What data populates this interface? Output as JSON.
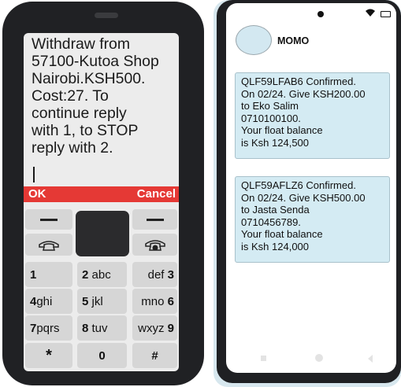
{
  "feature_phone": {
    "message": "Withdraw from\n57100-Kutoa Shop\nNairobi.KSH500.\nCost:27. To\ncontinue reply\nwith 1, to STOP\nreply with 2.",
    "softkey_left": "OK",
    "softkey_right": "Cancel",
    "keys": [
      {
        "num": "1",
        "letters": ""
      },
      {
        "num": "2",
        "letters": "abc"
      },
      {
        "num": "3",
        "letters": "def"
      },
      {
        "num": "4",
        "letters": "ghi"
      },
      {
        "num": "5",
        "letters": "jkl"
      },
      {
        "num": "6",
        "letters": "mno"
      },
      {
        "num": "7",
        "letters": "pqrs"
      },
      {
        "num": "8",
        "letters": "tuv"
      },
      {
        "num": "9",
        "letters": "wxyz"
      },
      {
        "num": "*",
        "letters": ""
      },
      {
        "num": "0",
        "letters": ""
      },
      {
        "num": "#",
        "letters": ""
      }
    ]
  },
  "smartphone": {
    "contact_name": "MOMO",
    "messages": [
      {
        "text": "QLF59LFAB6 Confirmed.\nOn 02/24. Give KSH200.00\nto Eko Salim\n0710100100.\nYour float balance\nis Ksh 124,500"
      },
      {
        "text": "QLF59AFLZ6 Confirmed.\nOn 02/24. Give KSH500.00\nto Jasta Senda\n0710456789.\nYour float balance\nis Ksh 124,000"
      }
    ]
  }
}
